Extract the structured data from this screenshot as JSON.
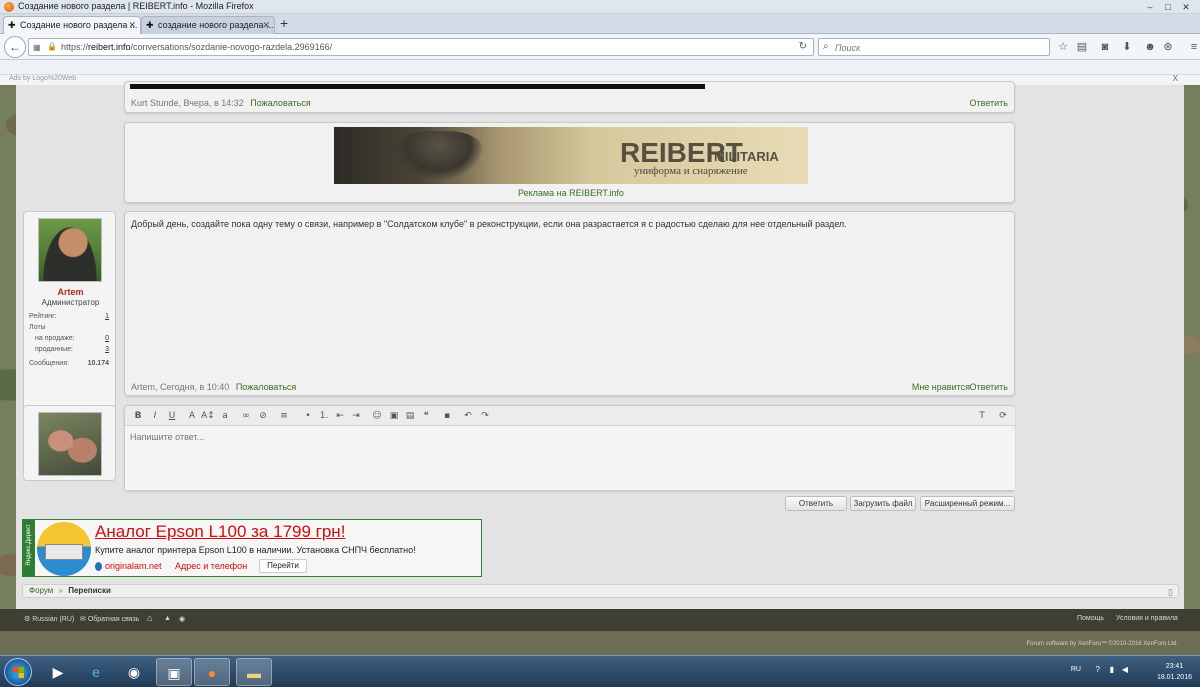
{
  "window": {
    "title": "Создание нового раздела | REIBERT.info - Mozilla Firefox",
    "controls": [
      "–",
      "□",
      "✕"
    ]
  },
  "tabs": [
    {
      "label": "Создание нового раздела ...",
      "active": true
    },
    {
      "label": "создание нового раздела ...",
      "active": false
    }
  ],
  "new_tab_label": "+",
  "navbar": {
    "url_prefix": "https://",
    "url_host": "reibert.info",
    "url_path": "/conversations/sozdanie-novogo-razdela.2969166/",
    "search_placeholder": "Поиск",
    "icons": [
      "star-icon",
      "reading-list-icon",
      "pocket-icon",
      "download-icon",
      "chat-icon",
      "sync-icon",
      "hex-icon",
      "menu-icon"
    ]
  },
  "ads_bar": {
    "label": "Ads by Logo%20Web",
    "close": "X"
  },
  "messages": [
    {
      "author_line": "Kurt Stunde, Вчера, в 14:32",
      "report": "Пожаловаться",
      "reply": "Ответить"
    }
  ],
  "banner": {
    "brand": "REIBERT",
    "brand_small": "MILITARIA",
    "tagline": "униформа и снаряжение",
    "caption": "Реклама на REIBERT.info"
  },
  "post": {
    "text": "Добрый день, создайте пока одну тему о связи, например в \"Солдатском клубе\" в реконструкции, если она разрастается я с радостью сделаю для нее отдельный раздел.",
    "author_line": "Artem, Сегодня, в 10:40",
    "report": "Пожаловаться",
    "like": "Мне нравится",
    "reply": "Ответить"
  },
  "user": {
    "name": "Artem",
    "role": "Администратор",
    "stats": {
      "rating_label": "Рейтинг:",
      "rating_value": "1",
      "lots_label": "Лоты",
      "on_sale_label": "на продаже:",
      "on_sale_value": "0",
      "sold_label": "проданные:",
      "sold_value": "3",
      "messages_label": "Сообщения:",
      "messages_value": "10.174"
    }
  },
  "editor": {
    "placeholder": "Напишите ответ...",
    "reply_button": "Ответить",
    "upload_button": "Загрузить файл",
    "advanced_button": "Расширенный режим..."
  },
  "ad": {
    "side_label": "Яндекс.Директ",
    "title": "Аналог Epson L100 за 1799 грн!",
    "description": "Купите аналог принтера Epson L100 в наличии. Установка СНПЧ бесплатно!",
    "site": "originalam.net",
    "address": "Адрес и телефон",
    "go": "Перейти"
  },
  "breadcrumb": {
    "root": "Форум",
    "separator": "»",
    "current": "Переписки"
  },
  "footer": {
    "language": "Russian (RU)",
    "feedback": "Обратная связь",
    "help": "Помощь",
    "terms": "Условия и правила",
    "copyright": "Forum software by XenForo™ ©2010-2016 XenForo Ltd."
  },
  "taskbar": {
    "lang": "RU",
    "time": "23:41",
    "date": "18.01.2016"
  }
}
